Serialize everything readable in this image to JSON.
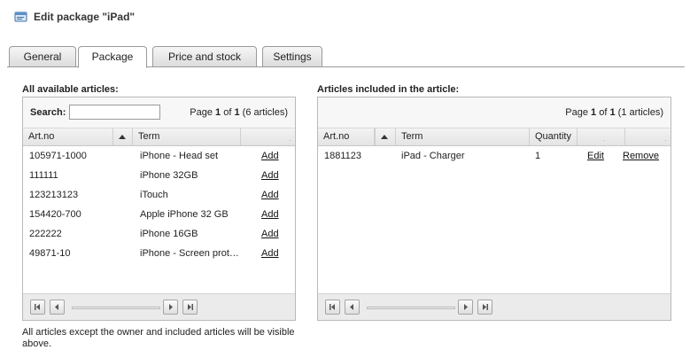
{
  "window": {
    "title": "Edit package \"iPad\"",
    "icon": "package-edit-icon"
  },
  "tabs": [
    {
      "label": "General",
      "active": false
    },
    {
      "label": "Package",
      "active": true
    },
    {
      "label": "Price and stock",
      "active": false
    },
    {
      "label": "Settings",
      "active": false
    }
  ],
  "available": {
    "title": "All available articles:",
    "search_label": "Search:",
    "search_value": "",
    "pager": {
      "prefix": "Page ",
      "page": "1",
      "of": " of ",
      "total": "1",
      "suffix": " (6 articles)"
    },
    "columns": {
      "artno": "Art.no",
      "term": "Term"
    },
    "rows": [
      {
        "artno": "105971-1000",
        "term": "iPhone - Head set",
        "action": "Add"
      },
      {
        "artno": "111111",
        "term": "iPhone 32GB",
        "action": "Add"
      },
      {
        "artno": "123213123",
        "term": "iTouch",
        "action": "Add"
      },
      {
        "artno": "154420-700",
        "term": "Apple iPhone 32 GB",
        "action": "Add"
      },
      {
        "artno": "222222",
        "term": "iPhone 16GB",
        "action": "Add"
      },
      {
        "artno": "49871-10",
        "term": "iPhone - Screen prot…",
        "action": "Add"
      }
    ],
    "footnote": "All articles except the owner and included articles will be visible above."
  },
  "included": {
    "title": "Articles included in the article:",
    "pager": {
      "prefix": "Page ",
      "page": "1",
      "of": " of ",
      "total": "1",
      "suffix": " (1 articles)"
    },
    "columns": {
      "artno": "Art.no",
      "term": "Term",
      "quantity": "Quantity"
    },
    "rows": [
      {
        "artno": "1881123",
        "term": "iPad - Charger",
        "quantity": "1",
        "edit": "Edit",
        "remove": "Remove"
      }
    ]
  },
  "colors": {
    "border": "#b9b9b9",
    "toolbar": "#ebebeb",
    "header": "#e4e4e4"
  }
}
